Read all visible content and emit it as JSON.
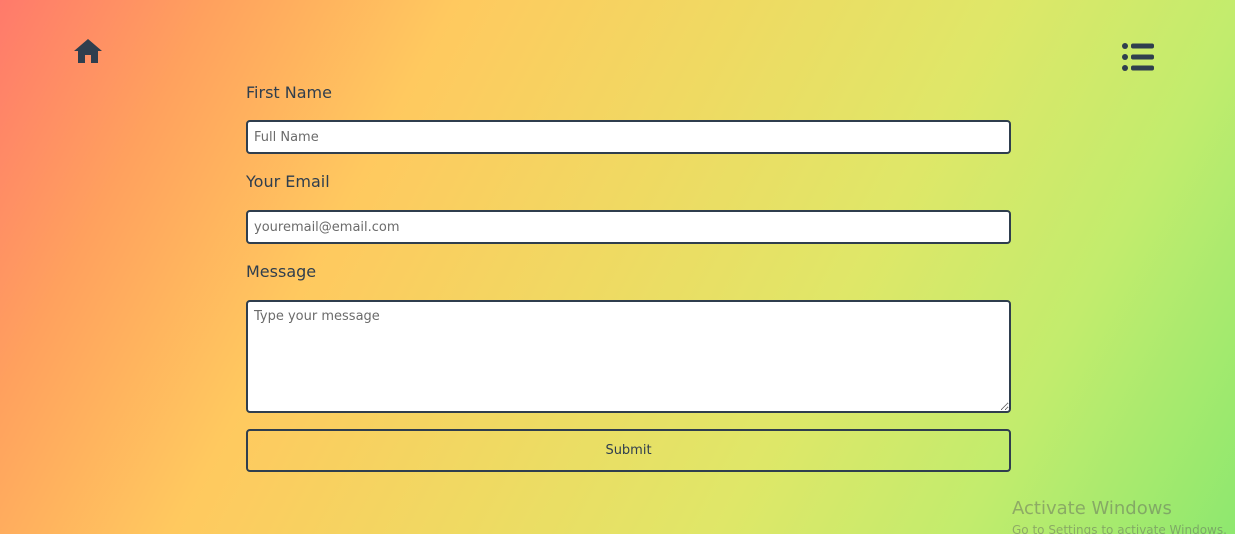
{
  "header": {
    "home_icon": "home-icon",
    "menu_icon": "list-menu-icon"
  },
  "form": {
    "name_label": "First Name",
    "name_placeholder": "Full Name",
    "email_label": "Your Email",
    "email_placeholder": "youremail@email.com",
    "message_label": "Message",
    "message_placeholder": "Type your message",
    "submit_label": "Submit"
  },
  "watermark": {
    "title": "Activate Windows",
    "subtitle": "Go to Settings to activate Windows."
  },
  "colors": {
    "text": "#2f3e4e",
    "field_bg": "#ffffff",
    "gradient_start": "#ff7a6b",
    "gradient_mid": "#ffc95f",
    "gradient_end": "#8ee86f"
  }
}
